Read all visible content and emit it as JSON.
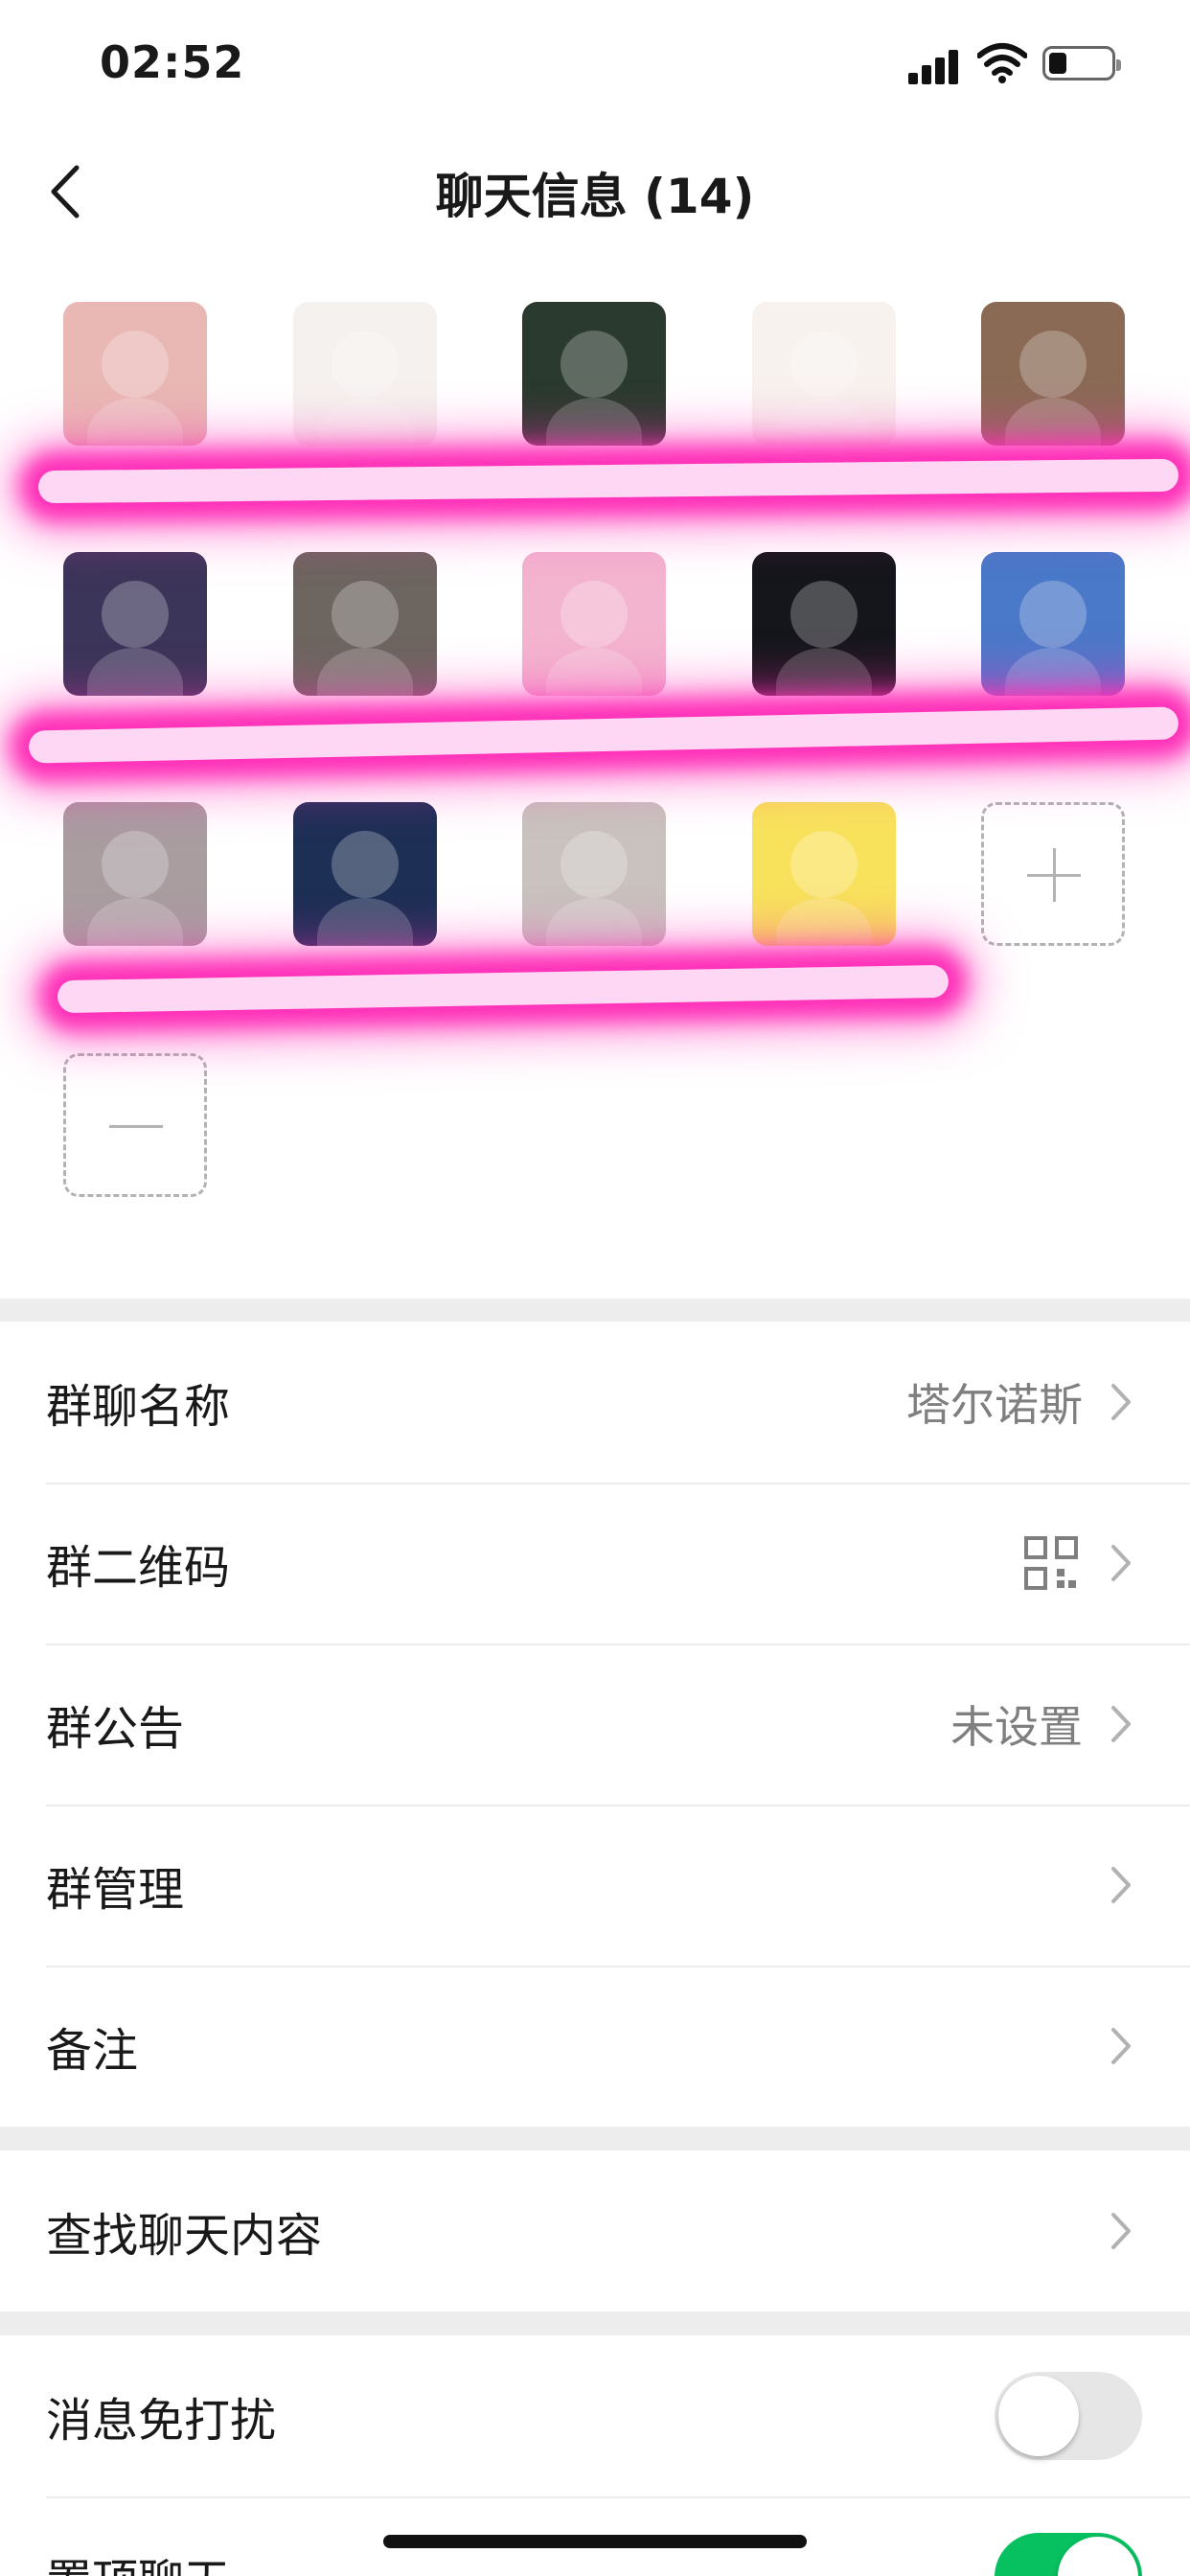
{
  "status_bar": {
    "time": "02:52"
  },
  "nav": {
    "title": "聊天信息 (14)"
  },
  "members": [
    {
      "avatar": "member-1",
      "color": "#e9b7b4"
    },
    {
      "avatar": "member-2",
      "color": "#f5f1ee"
    },
    {
      "avatar": "member-3",
      "color": "#2a3a2e"
    },
    {
      "avatar": "member-4",
      "color": "#f7f2ee"
    },
    {
      "avatar": "member-5",
      "color": "#8a6a55"
    },
    {
      "avatar": "member-6",
      "color": "#3b3559"
    },
    {
      "avatar": "member-7",
      "color": "#6d6560"
    },
    {
      "avatar": "member-8",
      "color": "#f3b4cf"
    },
    {
      "avatar": "member-9",
      "color": "#14161b"
    },
    {
      "avatar": "member-10",
      "color": "#4a79c9"
    },
    {
      "avatar": "member-11",
      "color": "#a99da0"
    },
    {
      "avatar": "member-12",
      "color": "#1d2f55"
    },
    {
      "avatar": "member-13",
      "color": "#c9c2be"
    },
    {
      "avatar": "member-14",
      "color": "#f8e25c"
    }
  ],
  "settings": {
    "group_name": {
      "label": "群聊名称",
      "value": "塔尔诺斯"
    },
    "group_qr": {
      "label": "群二维码"
    },
    "announcement": {
      "label": "群公告",
      "value": "未设置"
    },
    "manage": {
      "label": "群管理"
    },
    "remark": {
      "label": "备注"
    },
    "search_history": {
      "label": "查找聊天内容"
    },
    "mute": {
      "label": "消息免打扰",
      "on": false
    },
    "pin": {
      "label": "置顶聊天",
      "on": true
    }
  },
  "colors": {
    "accent_green": "#07c160",
    "redaction_pink": "#ff2fb8"
  }
}
